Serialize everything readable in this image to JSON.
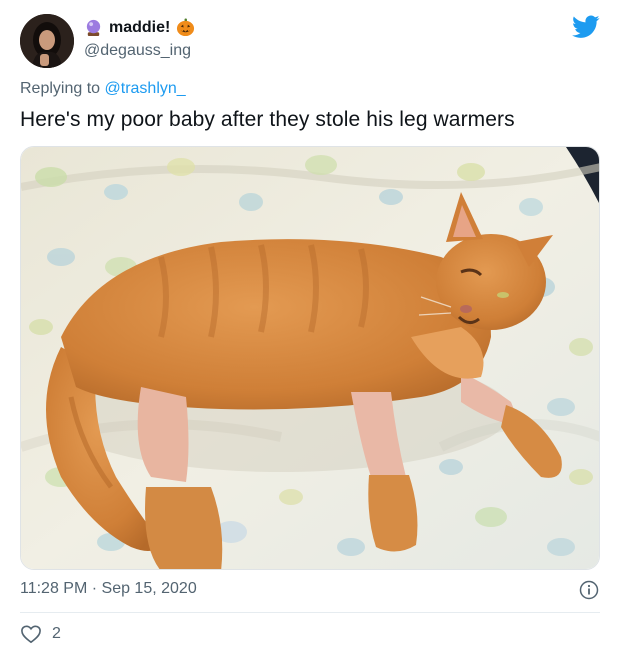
{
  "author": {
    "name": "maddie!",
    "handle": "@degauss_ing",
    "name_icons": [
      "crystal-ball-icon",
      "jack-o-lantern-icon"
    ]
  },
  "reply": {
    "prefix": "Replying to",
    "to_handle": "@trashlyn_"
  },
  "tweet": {
    "text": "Here's my poor baby after they stole his leg warmers",
    "timestamp": "11:28 PM · Sep 15, 2020",
    "likes": "2"
  },
  "colors": {
    "twitter_blue": "#1d9bf0",
    "secondary_text": "#536471",
    "primary_text": "#0f1419",
    "cat_orange": "#d7863e"
  }
}
